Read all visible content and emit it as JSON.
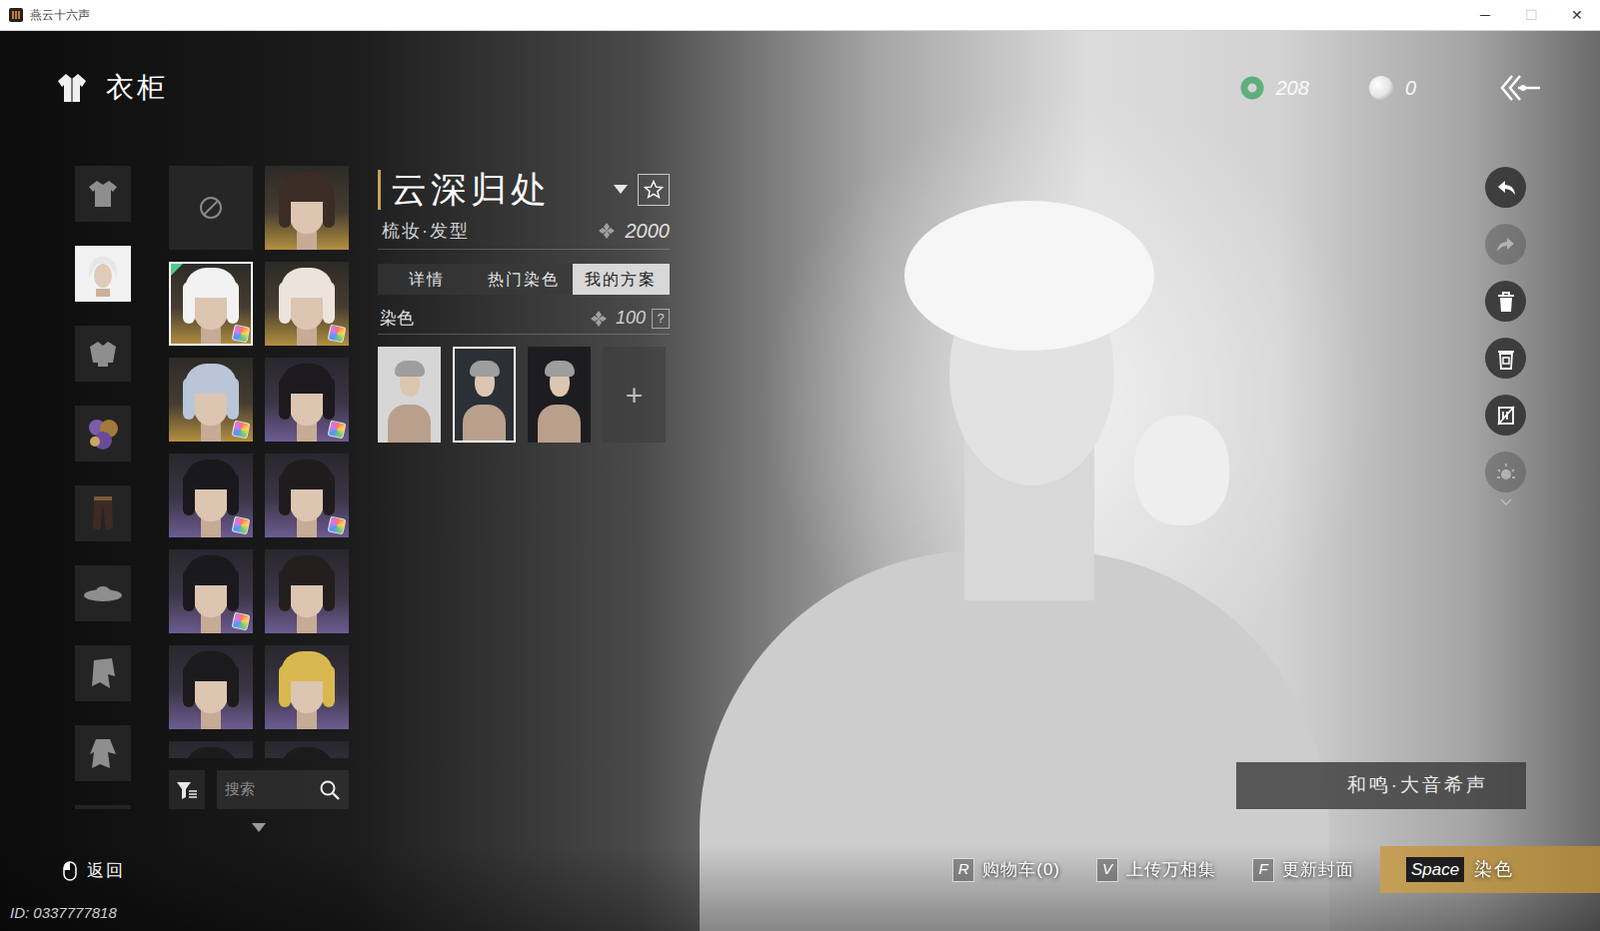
{
  "window": {
    "title": "燕云十六声",
    "controls": [
      {
        "label": "─",
        "disabled": false
      },
      {
        "label": "☐",
        "disabled": true
      },
      {
        "label": "✕",
        "disabled": false
      }
    ]
  },
  "header": {
    "title": "衣柜",
    "currencies": [
      {
        "amount": "208",
        "color": "#5fae7e"
      },
      {
        "amount": "0",
        "color": "#e4e4e4"
      }
    ]
  },
  "categories": [
    {
      "selected": false
    },
    {
      "selected": true
    },
    {
      "selected": false
    },
    {
      "selected": false
    },
    {
      "selected": false
    },
    {
      "selected": false
    },
    {
      "selected": false
    },
    {
      "selected": false
    },
    {
      "selected": false
    }
  ],
  "styles": [
    {
      "kind": "none",
      "color": "#2a2a2a",
      "selected": false,
      "equipped": false,
      "dye": false
    },
    {
      "kind": "gold",
      "color": "#3b2d25",
      "selected": false,
      "equipped": false,
      "dye": false
    },
    {
      "kind": "gold",
      "color": "#f2f2f2",
      "selected": true,
      "equipped": true,
      "dye": true
    },
    {
      "kind": "gold",
      "color": "#ece4dc",
      "selected": false,
      "equipped": false,
      "dye": true
    },
    {
      "kind": "gold",
      "color": "#b9c6d8",
      "selected": false,
      "equipped": false,
      "dye": true
    },
    {
      "kind": "purple",
      "color": "#1c1a1e",
      "selected": false,
      "equipped": false,
      "dye": true
    },
    {
      "kind": "purple",
      "color": "#19181c",
      "selected": false,
      "equipped": false,
      "dye": true
    },
    {
      "kind": "purple",
      "color": "#1f1c1e",
      "selected": false,
      "equipped": false,
      "dye": true
    },
    {
      "kind": "purple",
      "color": "#1a191d",
      "selected": false,
      "equipped": false,
      "dye": true
    },
    {
      "kind": "purple",
      "color": "#231f1e",
      "selected": false,
      "equipped": false,
      "dye": false
    },
    {
      "kind": "purple",
      "color": "#1b1a1c",
      "selected": false,
      "equipped": false,
      "dye": false
    },
    {
      "kind": "purple",
      "color": "#d9b94f",
      "selected": false,
      "equipped": false,
      "dye": false
    },
    {
      "kind": "purple",
      "color": "#1b1a1c",
      "selected": false,
      "equipped": false,
      "dye": false
    },
    {
      "kind": "purple",
      "color": "#1b1a1c",
      "selected": false,
      "equipped": false,
      "dye": false
    }
  ],
  "search": {
    "placeholder": "搜索"
  },
  "detail": {
    "title": "云深归处",
    "category": "梳妆·发型",
    "price": "2000",
    "favorited": false,
    "tabs": [
      {
        "label": "详情",
        "selected": false
      },
      {
        "label": "热门染色",
        "selected": false
      },
      {
        "label": "我的方案",
        "selected": true
      }
    ],
    "dye": {
      "label": "染色",
      "price": "100",
      "help": "?"
    },
    "schemes": [
      {
        "selected": false,
        "color": "#d6d6d6"
      },
      {
        "selected": true,
        "color": "#2b3036"
      },
      {
        "selected": false,
        "color": "#1d1c20"
      }
    ],
    "add": "+"
  },
  "tools": [
    {
      "disabled": false
    },
    {
      "disabled": true
    },
    {
      "disabled": false
    },
    {
      "disabled": false
    },
    {
      "disabled": false
    },
    {
      "disabled": true
    }
  ],
  "skin_label": "和鸣·大音希声",
  "footer": {
    "back": "返回",
    "id": "ID: 0337777818",
    "hints": [
      {
        "key": "R",
        "label": "购物车(0)"
      },
      {
        "key": "V",
        "label": "上传万相集"
      },
      {
        "key": "F",
        "label": "更新封面"
      }
    ],
    "primary": {
      "key": "Space",
      "label": "染色"
    }
  }
}
